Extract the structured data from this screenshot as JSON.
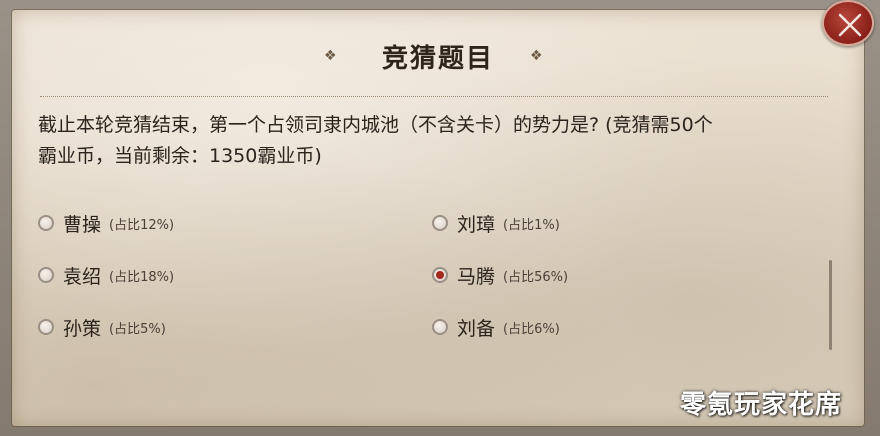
{
  "dialog": {
    "title": "竞猜题目",
    "ornament_left": "❖",
    "ornament_right": "❖",
    "question_line1": "截止本轮竞猜结束，第一个占领司隶内城池（不含关卡）的势力是? (竞猜需50个",
    "question_line2": "霸业币，当前剩余：1350霸业币)",
    "options": [
      {
        "name": "曹操",
        "share": "(占比12%)",
        "selected": false
      },
      {
        "name": "刘璋",
        "share": "(占比1%)",
        "selected": false
      },
      {
        "name": "袁绍",
        "share": "(占比18%)",
        "selected": false
      },
      {
        "name": "马腾",
        "share": "(占比56%)",
        "selected": true
      },
      {
        "name": "孙策",
        "share": "(占比5%)",
        "selected": false
      },
      {
        "name": "刘备",
        "share": "(占比6%)",
        "selected": false
      }
    ],
    "close_icon": "close-icon",
    "accent_color": "#a0281d"
  },
  "watermark": "零氪玩家花席"
}
